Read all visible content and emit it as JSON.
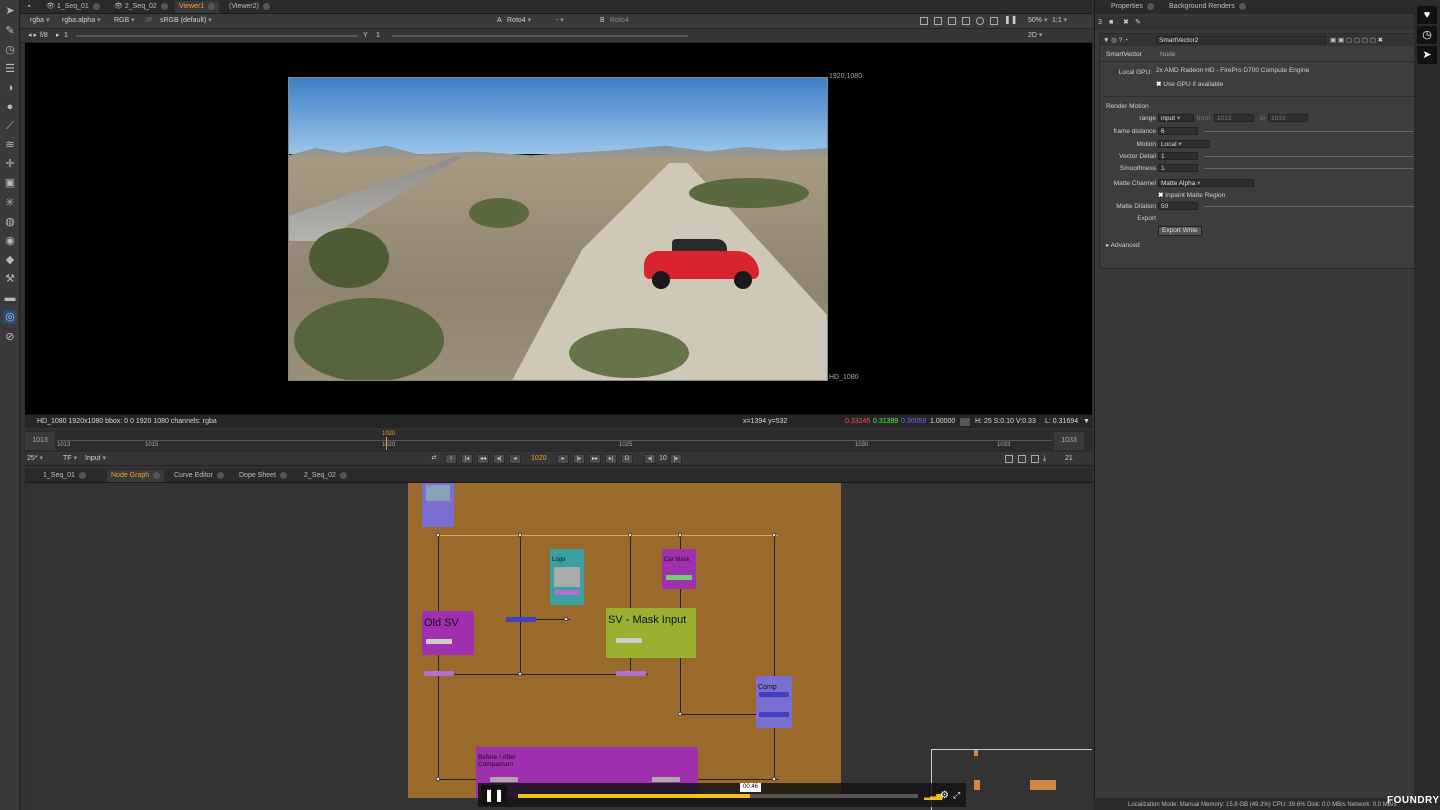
{
  "toolbar": {
    "icons": [
      "pointer-icon",
      "paint-icon",
      "time-icon",
      "channel-icon",
      "color-icon",
      "sphere-icon",
      "draw-icon",
      "stack-icon",
      "transform-icon",
      "3d-icon",
      "particle-icon",
      "deep-icon",
      "view-icon",
      "keyer-icon",
      "merge-icon",
      "filter-icon",
      "smartvector-icon",
      "other-icon"
    ]
  },
  "viewer_tabs": [
    {
      "label": "1_Seq_01",
      "active": false
    },
    {
      "label": "2_Seq_02",
      "active": false
    },
    {
      "label": "Viewer1",
      "active": true
    },
    {
      "label": "(Viewer2)",
      "active": false
    }
  ],
  "viewer_bar1": {
    "channels": "rgba",
    "alpha": "rgba.alpha",
    "display": "RGB",
    "ip": "IP",
    "colorspace": "sRGB (default)",
    "input_a_letter": "A",
    "input_a": "Roto4",
    "wipe": "-",
    "input_b_letter": "B",
    "input_b": "Roto4",
    "zoom": "50%",
    "ratio": "1:1"
  },
  "viewer_bar2": {
    "fstop": "f/8",
    "gain": "1",
    "gamma_label": "Y",
    "gamma": "1",
    "mode": "2D"
  },
  "viewer": {
    "format_top": "1920,1080",
    "format_bottom": "HD_1080"
  },
  "viewer_status": {
    "info": "HD_1080 1920x1080  bbox: 0 0 1920 1080 channels: rgba",
    "coords": "x=1394 y=532",
    "r": "0.33245",
    "g": "0.31399",
    "b": "0.30059",
    "a": "1.00000",
    "hsv": "H: 25 S:0.10 V:0.33",
    "lum": "L: 0.31694"
  },
  "timeline": {
    "start": "1013",
    "end": "1033",
    "current": "1020",
    "ticks": [
      "1013",
      "1015",
      "1020",
      "1025",
      "1030",
      "1033"
    ]
  },
  "playbar": {
    "fps": "25*",
    "tf": "TF",
    "range": "Input",
    "frame": "1020",
    "step": "10",
    "end_frame": "21"
  },
  "ng_tabs": [
    {
      "label": "1_Seq_01",
      "active": false
    },
    {
      "label": "Node Graph",
      "active": true
    },
    {
      "label": "Curve Editor",
      "active": false
    },
    {
      "label": "Dope Sheet",
      "active": false
    },
    {
      "label": "2_Seq_02",
      "active": false
    }
  ],
  "node_graph": {
    "nodes": {
      "logo": "Logo",
      "car_mask": "Car Mask",
      "old_sv": "Old SV",
      "sv_mask": "SV - Mask Input",
      "comp": "Comp",
      "before_after": "Before / After Comparison"
    }
  },
  "video": {
    "time": "00:46",
    "progress": 0.58
  },
  "props_tabs": [
    {
      "label": "Properties"
    },
    {
      "label": "Background Renders"
    }
  ],
  "props_bar": {
    "count": "3"
  },
  "panel": {
    "node_name": "SmartVector2",
    "tab_main": "SmartVector",
    "tab_node": "Node",
    "local_gpu_label": "Local GPU:",
    "local_gpu_value": "2x AMD Radeon HD - FirePro D700 Compute Engine",
    "use_gpu": "Use GPU if available",
    "render_motion": "Render Motion",
    "range_label": "range",
    "range_value": "input",
    "from_label": "from",
    "from_value": "1013",
    "to_label": "to",
    "to_value": "1033",
    "frame_distance_label": "frame distance",
    "frame_distance": "6",
    "motion_label": "Motion",
    "motion_value": "Local",
    "vector_detail_label": "Vector Detail",
    "vector_detail": "1",
    "smoothness_label": "Smoothness",
    "smoothness": "1",
    "matte_channel_label": "Matte Channel",
    "matte_channel": "Matte Alpha",
    "inpaint": "Inpaint Matte Region",
    "matte_dilation_label": "Matte Dilation",
    "matte_dilation": "50",
    "export_label": "Export",
    "export_button": "Export Write",
    "advanced": "Advanced"
  },
  "status_line": "Localization Mode: Manual  Memory: 15.8 GB (49.2%)  CPU: 39.6%  Disk: 0.0 MB/s  Network: 0.0 MB/s",
  "brand": "FOUNDRY"
}
